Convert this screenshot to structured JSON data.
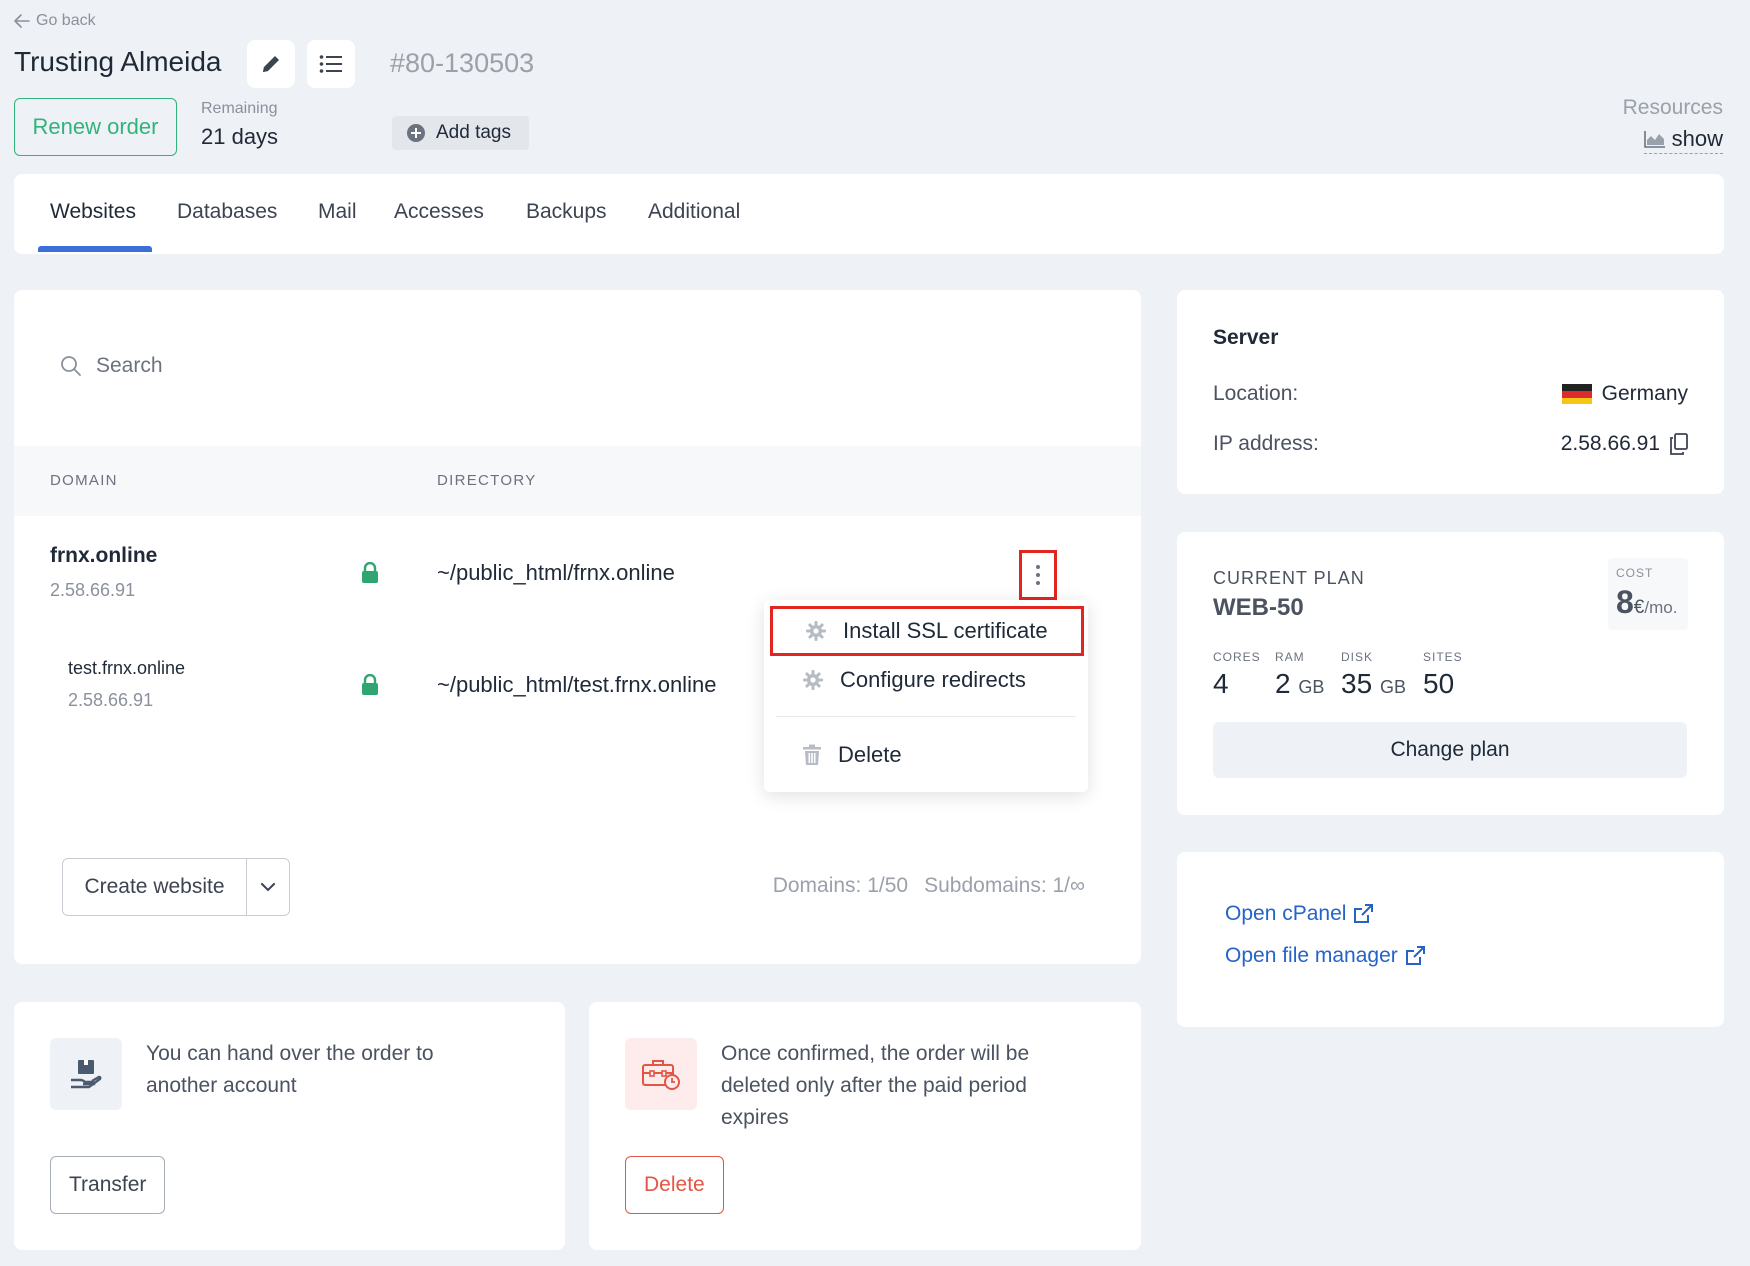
{
  "header": {
    "go_back": "Go back",
    "title": "Trusting Almeida",
    "order_number": "#80-130503",
    "renew_label": "Renew order",
    "remaining_label": "Remaining",
    "remaining_value": "21 days",
    "add_tags_label": "Add tags",
    "resources_label": "Resources",
    "resources_show": "show"
  },
  "tabs": [
    {
      "label": "Websites",
      "active": true
    },
    {
      "label": "Databases"
    },
    {
      "label": "Mail"
    },
    {
      "label": "Accesses"
    },
    {
      "label": "Backups"
    },
    {
      "label": "Additional"
    }
  ],
  "websites": {
    "search_placeholder": "Search",
    "columns": {
      "domain": "DOMAIN",
      "directory": "DIRECTORY"
    },
    "rows": [
      {
        "domain": "frnx.online",
        "ip": "2.58.66.91",
        "directory": "~/public_html/frnx.online"
      },
      {
        "domain": "test.frnx.online",
        "ip": "2.58.66.91",
        "directory": "~/public_html/test.frnx.online"
      }
    ],
    "create_label": "Create website",
    "domains_count": "Domains: 1/50",
    "subdomains_count": "Subdomains: 1/∞"
  },
  "context_menu": {
    "items": [
      {
        "label": "Install SSL certificate",
        "icon": "gear-icon"
      },
      {
        "label": "Configure redirects",
        "icon": "gear-icon"
      },
      {
        "label": "Delete",
        "icon": "trash-icon"
      }
    ]
  },
  "transfer_card": {
    "text": "You can hand over the order to another account",
    "button": "Transfer"
  },
  "delete_card": {
    "text": "Once confirmed, the order will be deleted only after the paid period expires",
    "button": "Delete"
  },
  "server": {
    "title": "Server",
    "location_label": "Location:",
    "location_value": "Germany",
    "ip_label": "IP address:",
    "ip_value": "2.58.66.91"
  },
  "plan": {
    "label": "CURRENT PLAN",
    "name": "WEB-50",
    "cost_label": "COST",
    "cost_value": "8",
    "cost_currency": "€",
    "cost_period": "/mo.",
    "specs": [
      {
        "label": "CORES",
        "value": "4",
        "unit": ""
      },
      {
        "label": "RAM",
        "value": "2",
        "unit": "GB"
      },
      {
        "label": "DISK",
        "value": "35",
        "unit": "GB"
      },
      {
        "label": "SITES",
        "value": "50",
        "unit": ""
      }
    ],
    "change_plan": "Change plan"
  },
  "links": {
    "cpanel": "Open cPanel",
    "file_manager": "Open file manager"
  },
  "colors": {
    "accent_blue": "#3b6fd8",
    "green": "#34b27b",
    "danger": "#e45545",
    "highlight_red": "#e0261f",
    "link": "#2563c9"
  }
}
